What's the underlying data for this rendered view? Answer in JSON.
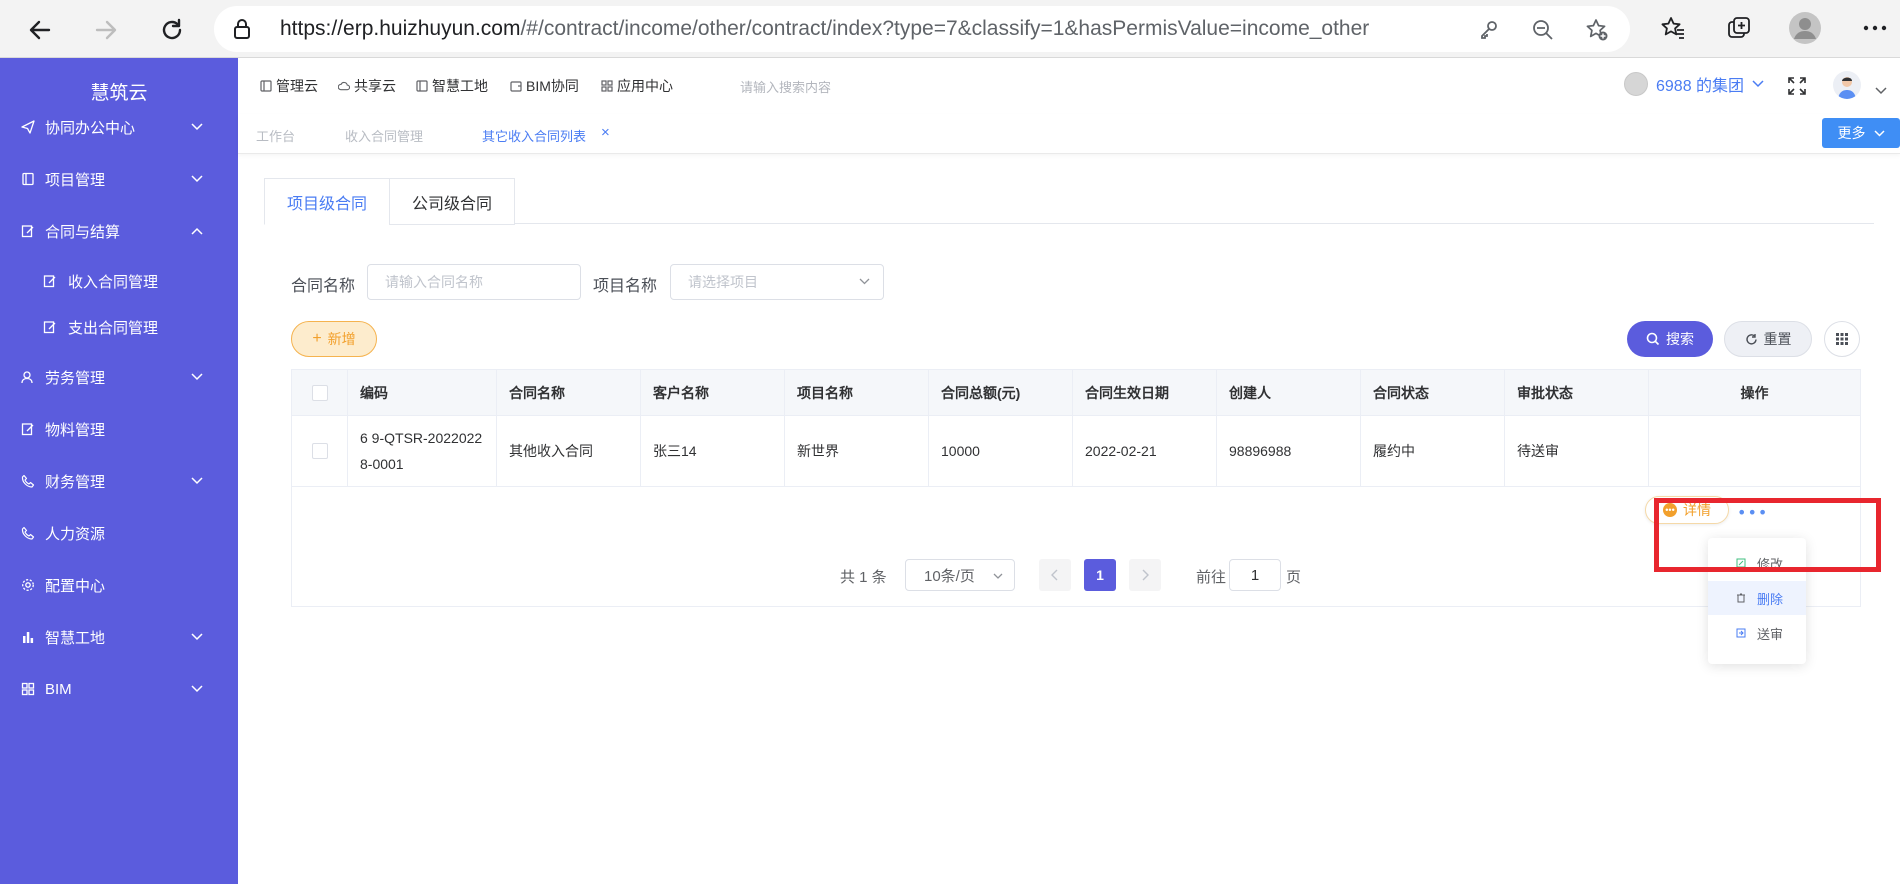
{
  "browser": {
    "url_main": "https://erp.huizhuyun.com",
    "url_rest": "/#/contract/income/other/contract/index?type=7&classify=1&hasPermisValue=income_other"
  },
  "sidebar": {
    "brand": "慧筑云",
    "items": [
      {
        "label": "协同办公中心",
        "icon": "send-icon",
        "arrow": "down"
      },
      {
        "label": "项目管理",
        "icon": "book-icon",
        "arrow": "down"
      },
      {
        "label": "合同与结算",
        "icon": "edit-icon",
        "arrow": "up"
      },
      {
        "label": "收入合同管理",
        "icon": "edit-icon",
        "sub": true
      },
      {
        "label": "支出合同管理",
        "icon": "edit-icon",
        "sub": true
      },
      {
        "label": "劳务管理",
        "icon": "users-icon",
        "arrow": "down"
      },
      {
        "label": "物料管理",
        "icon": "edit-icon"
      },
      {
        "label": "财务管理",
        "icon": "phone-icon",
        "arrow": "down"
      },
      {
        "label": "人力资源",
        "icon": "phone-icon"
      },
      {
        "label": "配置中心",
        "icon": "gear-icon"
      },
      {
        "label": "智慧工地",
        "icon": "bar-chart-icon",
        "arrow": "down"
      },
      {
        "label": "BIM",
        "icon": "grid-icon",
        "arrow": "down"
      }
    ]
  },
  "topnav": {
    "links": [
      "管理云",
      "共享云",
      "智慧工地",
      "BIM协同",
      "应用中心"
    ],
    "search_placeholder": "请输入搜索内容",
    "group": "6988 的集团"
  },
  "tabs": {
    "items": [
      "工作台",
      "收入合同管理",
      "其它收入合同列表"
    ],
    "close": "×",
    "more": "更多"
  },
  "level_tabs": [
    "项目级合同",
    "公司级合同"
  ],
  "filters": {
    "contract_name_label": "合同名称",
    "contract_name_placeholder": "请输入合同名称",
    "project_name_label": "项目名称",
    "project_name_placeholder": "请选择项目"
  },
  "toolbar": {
    "add": "新增",
    "search": "搜索",
    "reset": "重置"
  },
  "table": {
    "headers": [
      "编码",
      "合同名称",
      "客户名称",
      "项目名称",
      "合同总额(元)",
      "合同生效日期",
      "创建人",
      "合同状态",
      "审批状态",
      "操作"
    ],
    "rows": [
      {
        "code_line1": "6 9-QTSR-2022022",
        "code_line2": "8-0001",
        "name": "其他收入合同",
        "customer": "张三14",
        "project": "新世界",
        "amount": "10000",
        "date": "2022-02-21",
        "creator": "98896988",
        "status": "履约中",
        "approval": "待送审",
        "detail": "详情"
      }
    ]
  },
  "pagination": {
    "total": "共 1 条",
    "page_size": "10条/页",
    "current": "1",
    "goto_label": "前往",
    "goto_value": "1",
    "page_label": "页"
  },
  "dropdown": {
    "items": [
      "修改",
      "删除",
      "送审"
    ]
  },
  "colors": {
    "sidebar": "#5b5cdd",
    "primary": "#5b5cdd",
    "link": "#4a7cf3",
    "warning": "#f2a02c",
    "highlight": "#e8262e"
  }
}
